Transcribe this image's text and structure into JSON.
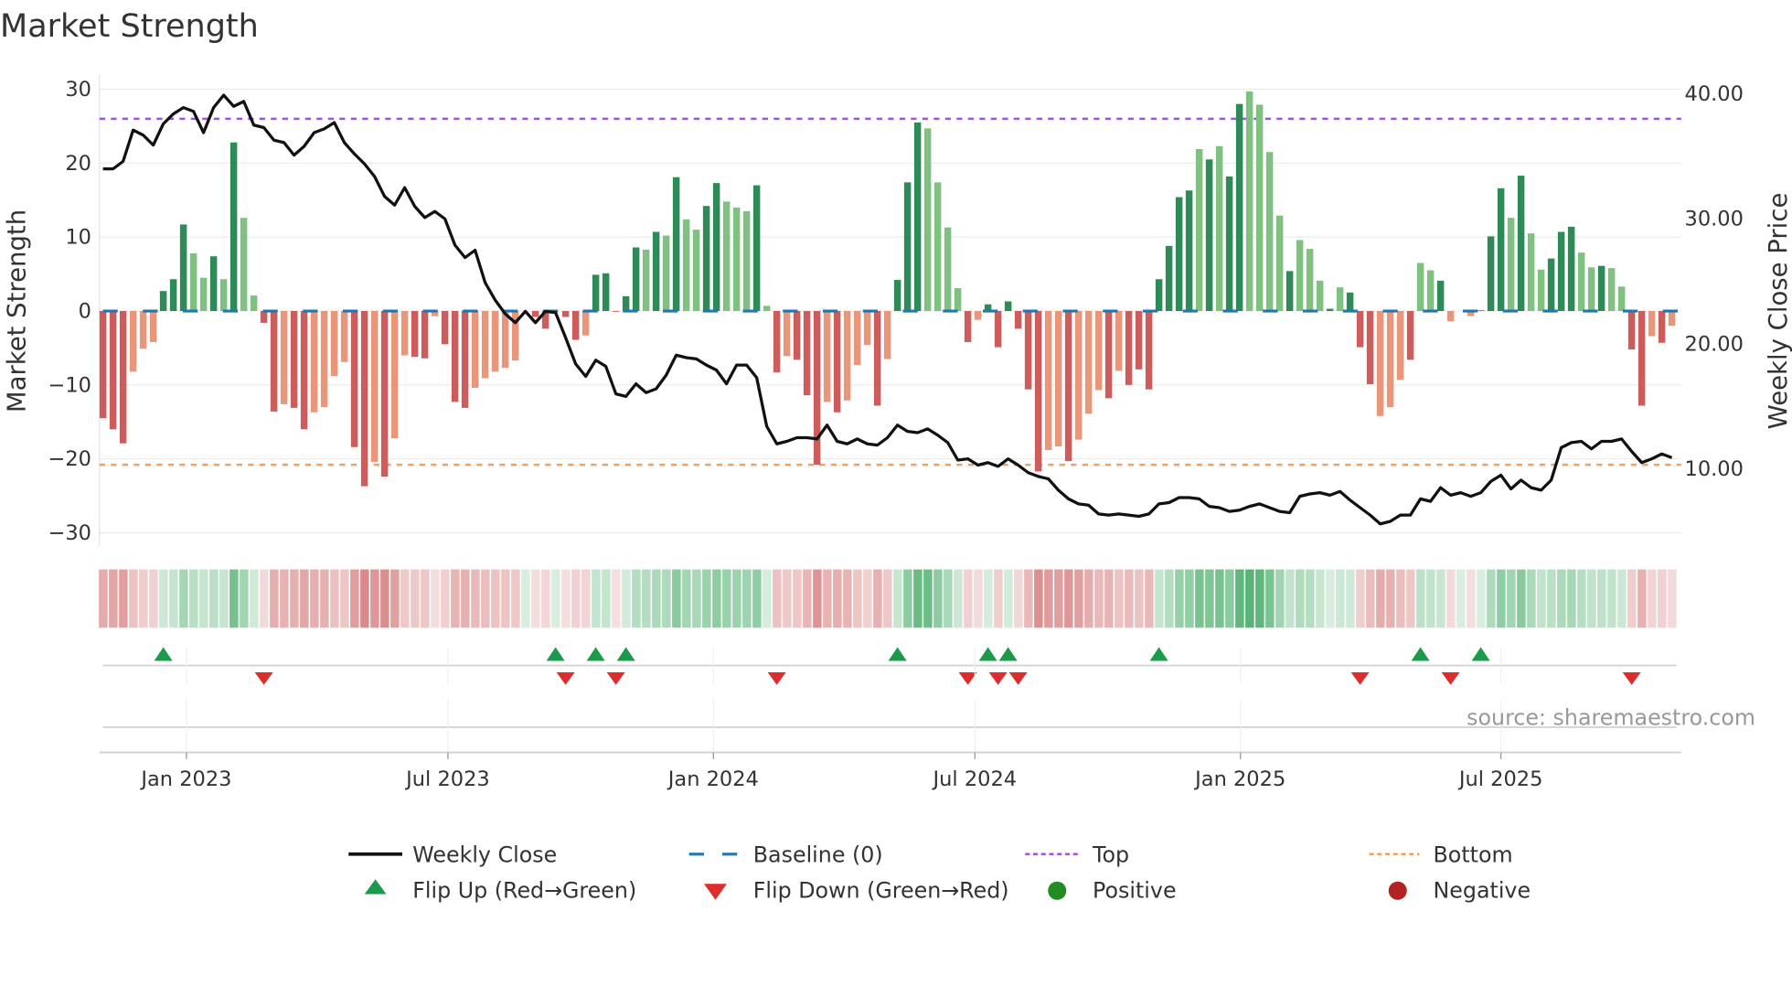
{
  "title": "Market Strength",
  "source": "source: sharemaestro.com",
  "chart_data": {
    "type": "bar",
    "title": "Market Strength",
    "ylabel": "Market Strength",
    "y2label": "Weekly Close Price",
    "ylim": [
      -32,
      31
    ],
    "y2lim": [
      3.5,
      41.5
    ],
    "yticks": [
      "30",
      "20",
      "10",
      "0",
      "−10",
      "−20",
      "−30"
    ],
    "ytick_values": [
      30,
      20,
      10,
      0,
      -10,
      -20,
      -30
    ],
    "y2ticks": [
      "40.00",
      "30.00",
      "20.00",
      "10.00"
    ],
    "y2tick_values": [
      40,
      30,
      20,
      10
    ],
    "xticks": [
      {
        "label": "Jan 2023",
        "week": 8.3
      },
      {
        "label": "Jul 2023",
        "week": 34.3
      },
      {
        "label": "Jan 2024",
        "week": 60.7
      },
      {
        "label": "Jul 2024",
        "week": 86.7
      },
      {
        "label": "Jan 2025",
        "week": 113.1
      },
      {
        "label": "Jul 2025",
        "week": 139.0
      }
    ],
    "grid": true,
    "top_level": 26,
    "bottom_level": -20.8,
    "baseline": 0,
    "strength": [
      -14.5,
      -16.0,
      -17.9,
      -8.2,
      -5.1,
      -4.2,
      2.7,
      4.3,
      11.7,
      7.8,
      4.5,
      7.4,
      4.3,
      22.8,
      12.6,
      2.1,
      -1.6,
      -13.6,
      -12.6,
      -13.1,
      -16.0,
      -13.7,
      -13.0,
      -8.8,
      -6.9,
      -18.4,
      -23.7,
      -20.4,
      -22.4,
      -17.2,
      -6.0,
      -6.2,
      -6.4,
      -0.7,
      -4.5,
      -12.3,
      -13.1,
      -10.4,
      -9.1,
      -8.2,
      -7.7,
      -6.7,
      0,
      -0.8,
      -2.4,
      0.1,
      -0.8,
      -3.9,
      -3.3,
      4.9,
      5.1,
      -0.1,
      2.0,
      8.6,
      8.3,
      10.7,
      10.2,
      18.1,
      12.4,
      11.0,
      14.2,
      17.3,
      14.8,
      14.0,
      13.5,
      17.0,
      0.7,
      -8.3,
      -6.1,
      -6.6,
      -11.4,
      -20.8,
      -12.3,
      -13.7,
      -12.1,
      -7.3,
      -4.6,
      -12.8,
      -6.5,
      4.2,
      17.4,
      25.5,
      24.7,
      17.4,
      11.3,
      3.1,
      -4.2,
      -1.2,
      0.9,
      -4.9,
      1.3,
      -2.4,
      -10.6,
      -21.7,
      -18.8,
      -18.3,
      -20.3,
      -17.4,
      -13.9,
      -10.7,
      -11.8,
      -8.1,
      -10.0,
      -7.9,
      -10.6,
      4.3,
      8.8,
      15.4,
      16.3,
      21.9,
      20.5,
      22.3,
      18.2,
      28.0,
      29.7,
      27.9,
      21.5,
      12.9,
      5.4,
      9.6,
      8.4,
      4.1,
      0.3,
      3.2,
      2.5,
      -4.9,
      -9.9,
      -14.2,
      -13.0,
      -9.3,
      -6.6,
      6.5,
      5.5,
      4.1,
      -1.4,
      0,
      -0.7,
      0.1,
      10.1,
      16.6,
      12.6,
      18.3,
      10.5,
      5.6,
      7.1,
      10.7,
      11.4,
      7.9,
      5.9,
      6.1,
      5.8,
      3.3,
      -5.2,
      -12.8,
      -3.4,
      -4.3,
      -2.0
    ],
    "shade": "dddllldddlldldllddlddllllddldllddldddllllllddlddldddddldldllddllldldldddldllldldddlllldldd ddddlldllldldddddddldlddlllldllldldddllldlldldldddldlldddlldllddldl",
    "weekly_close": [
      33.9,
      33.9,
      34.5,
      37.0,
      36.6,
      35.8,
      37.5,
      38.3,
      38.8,
      38.5,
      36.8,
      38.8,
      39.8,
      38.9,
      39.3,
      37.4,
      37.2,
      36.2,
      36.0,
      35.0,
      35.7,
      36.8,
      37.1,
      37.6,
      36.0,
      35.1,
      34.3,
      33.3,
      31.7,
      31.0,
      32.4,
      30.9,
      30.0,
      30.5,
      29.9,
      27.8,
      26.8,
      27.4,
      24.8,
      23.4,
      22.3,
      21.6,
      22.5,
      21.6,
      22.5,
      22.4,
      20.4,
      18.3,
      17.3,
      18.6,
      18.1,
      15.9,
      15.7,
      16.7,
      16.0,
      16.3,
      17.4,
      19.0,
      18.8,
      18.7,
      18.2,
      17.8,
      16.7,
      18.2,
      18.2,
      17.2,
      13.3,
      11.9,
      12.1,
      12.4,
      12.4,
      12.3,
      13.4,
      12.1,
      11.9,
      12.3,
      11.9,
      11.8,
      12.4,
      13.4,
      12.9,
      12.8,
      13.1,
      12.6,
      12.0,
      10.6,
      10.7,
      10.2,
      10.4,
      10.1,
      10.7,
      10.2,
      9.6,
      9.3,
      9.1,
      8.2,
      7.5,
      7.1,
      7.0,
      6.3,
      6.2,
      6.3,
      6.2,
      6.1,
      6.3,
      7.1,
      7.2,
      7.6,
      7.6,
      7.5,
      6.9,
      6.8,
      6.5,
      6.6,
      6.9,
      7.1,
      6.8,
      6.5,
      6.4,
      7.7,
      7.9,
      8.0,
      7.8,
      8.1,
      7.4,
      6.8,
      6.2,
      5.5,
      5.7,
      6.2,
      6.2,
      7.5,
      7.3,
      8.4,
      7.8,
      8.0,
      7.7,
      8.0,
      8.9,
      9.4,
      8.3,
      9.0,
      8.4,
      8.2,
      9.0,
      11.6,
      12.0,
      12.1,
      11.5,
      12.1,
      12.1,
      12.3,
      11.3,
      10.4,
      10.7,
      11.1,
      10.8
    ],
    "flip_up_weeks": [
      7,
      46,
      50,
      53,
      80,
      89,
      91,
      106,
      132,
      138
    ],
    "flip_down_weeks": [
      17,
      47,
      52,
      68,
      87,
      90,
      92,
      126,
      135,
      153
    ],
    "colors": {
      "pos_strong": "#2e8b57",
      "pos_weak": "#80c080",
      "neg_strong": "#cd5c5c",
      "neg_weak": "#e9967a",
      "line": "#111111",
      "baseline": "#1f77b4",
      "top": "#9b59d9",
      "bottom": "#f0a060",
      "flip_up": "#1a9a4a",
      "flip_down": "#dd2c2c",
      "positive": "#228b22",
      "negative": "#b22222"
    },
    "legend": [
      {
        "label": "Weekly Close",
        "kind": "line"
      },
      {
        "label": "Baseline (0)",
        "kind": "baseline"
      },
      {
        "label": "Top",
        "kind": "top"
      },
      {
        "label": "Bottom",
        "kind": "bottom"
      },
      {
        "label": "Flip Up (Red→Green)",
        "kind": "up"
      },
      {
        "label": "Flip Down (Green→Red)",
        "kind": "down"
      },
      {
        "label": "Positive",
        "kind": "pos"
      },
      {
        "label": "Negative",
        "kind": "neg"
      }
    ],
    "legend_placement": "bottom"
  }
}
